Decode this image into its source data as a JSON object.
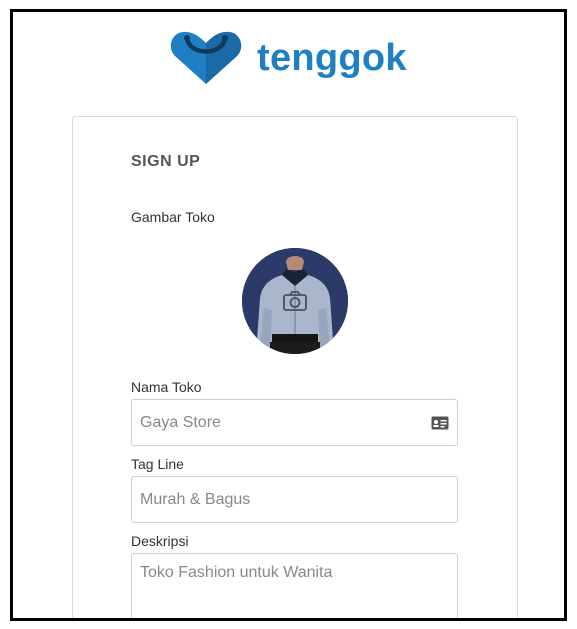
{
  "brand": {
    "name": "tenggok",
    "color": "#1f7fc4",
    "logo_icon": "heart-shopping-bag-icon"
  },
  "form": {
    "title": "SIGN UP",
    "store_image": {
      "label": "Gambar Toko",
      "camera_icon": "camera-icon"
    },
    "store_name": {
      "label": "Nama Toko",
      "placeholder": "Gaya Store",
      "icon": "id-card-icon"
    },
    "tag_line": {
      "label": "Tag Line",
      "placeholder": "Murah & Bagus"
    },
    "description": {
      "label": "Deskripsi",
      "placeholder": "Toko Fashion untuk Wanita"
    }
  }
}
